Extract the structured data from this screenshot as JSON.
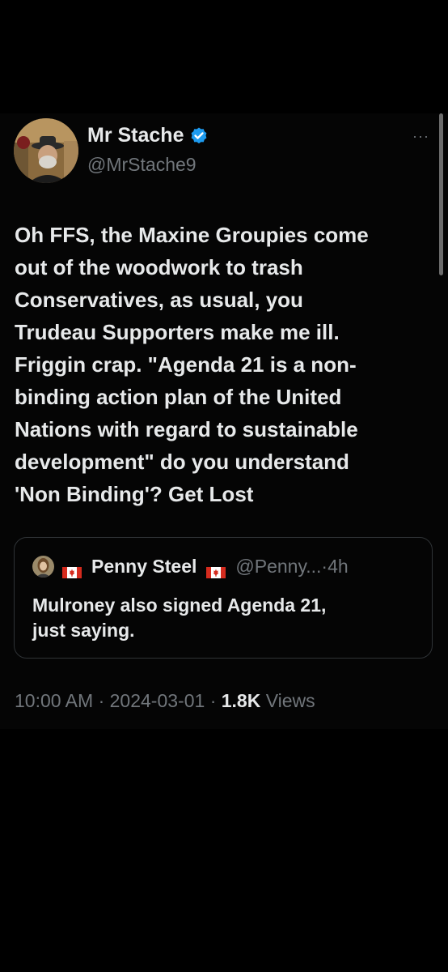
{
  "tweet": {
    "author": {
      "display_name": "Mr Stache",
      "handle": "@MrStache9",
      "verified": true
    },
    "more_menu": "···",
    "text_lines": [
      "Oh FFS, the Maxine Groupies come",
      "out of the woodwork to trash",
      "Conservatives, as usual, you",
      "Trudeau Supporters make me ill.",
      "Friggin crap. \"Agenda 21 is a non-",
      "binding action plan of the United",
      "Nations with regard to sustainable",
      "development\" do you understand",
      "'Non Binding'? Get Lost"
    ],
    "quote": {
      "display_name": "Penny Steel",
      "handle": "@Penny...",
      "separator": "·",
      "time": "4h",
      "text_lines": [
        "Mulroney also signed Agenda 21,",
        "just saying."
      ]
    },
    "meta": {
      "time": "10:00 AM",
      "date": "2024-03-01",
      "separator": "·",
      "views_count": "1.8K",
      "views_label": "Views"
    }
  },
  "colors": {
    "background": "#000000",
    "text_primary": "#e7e9ea",
    "text_secondary": "#71767b",
    "verified_blue": "#1d9bf0",
    "border": "#2f3336"
  }
}
